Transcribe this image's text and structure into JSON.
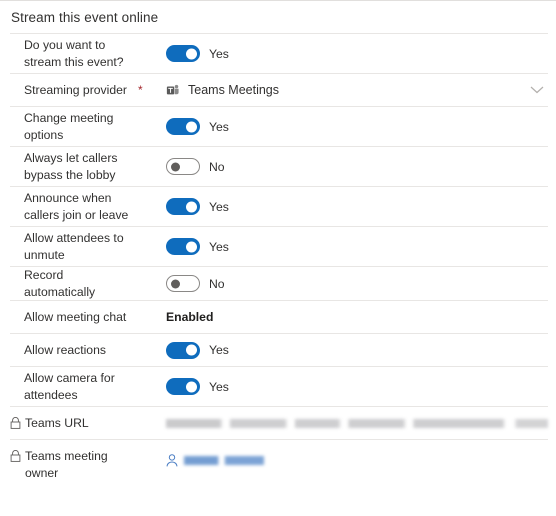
{
  "section": {
    "title": "Stream this event online"
  },
  "rows": [
    {
      "id": "stream-this-event",
      "label": "Do you want to stream this event?",
      "type": "toggle",
      "state": "on",
      "state_text": "Yes",
      "tall": true,
      "required": false,
      "locked": false
    },
    {
      "id": "streaming-provider",
      "label": "Streaming provider",
      "type": "provider",
      "value": "Teams Meetings",
      "icon": "teams-icon",
      "chevron": "chevron-down-icon",
      "tall": false,
      "required": true,
      "locked": false
    },
    {
      "id": "change-meeting-options",
      "label": "Change meeting options",
      "type": "toggle",
      "state": "on",
      "state_text": "Yes",
      "tall": true,
      "required": false,
      "locked": false
    },
    {
      "id": "bypass-lobby",
      "label": "Always let callers bypass the lobby",
      "type": "toggle",
      "state": "off",
      "state_text": "No",
      "tall": true,
      "required": false,
      "locked": false
    },
    {
      "id": "announce-callers",
      "label": "Announce when callers join or leave",
      "type": "toggle",
      "state": "on",
      "state_text": "Yes",
      "tall": true,
      "required": false,
      "locked": false
    },
    {
      "id": "attendees-unmute",
      "label": "Allow attendees to unmute",
      "type": "toggle",
      "state": "on",
      "state_text": "Yes",
      "tall": true,
      "required": false,
      "locked": false
    },
    {
      "id": "record-automatically",
      "label": "Record automatically",
      "type": "toggle",
      "state": "off",
      "state_text": "No",
      "tall": false,
      "required": false,
      "locked": false
    },
    {
      "id": "allow-meeting-chat",
      "label": "Allow meeting chat",
      "type": "static",
      "value": "Enabled",
      "tall": false,
      "required": false,
      "locked": false
    },
    {
      "id": "allow-reactions",
      "label": "Allow reactions",
      "type": "toggle",
      "state": "on",
      "state_text": "Yes",
      "tall": false,
      "required": false,
      "locked": false
    },
    {
      "id": "allow-camera",
      "label": "Allow camera for attendees",
      "type": "toggle",
      "state": "on",
      "state_text": "Yes",
      "tall": true,
      "required": false,
      "locked": false
    },
    {
      "id": "teams-url",
      "label": "Teams URL",
      "type": "redacted-url",
      "value": "",
      "tall": false,
      "required": false,
      "locked": true
    },
    {
      "id": "teams-meeting-owner",
      "label": "Teams meeting owner",
      "type": "redacted-person",
      "value": "",
      "tall": true,
      "required": false,
      "locked": true
    }
  ],
  "colors": {
    "toggle_on": "#0f6cbd",
    "toggle_off_border": "#8a8886",
    "toggle_off_knob": "#605e5c",
    "required_star": "#a4262c",
    "row_divider": "#e8e6e4",
    "text": "#323130",
    "person_link": "#4a7dc3"
  },
  "required_marker": "*"
}
